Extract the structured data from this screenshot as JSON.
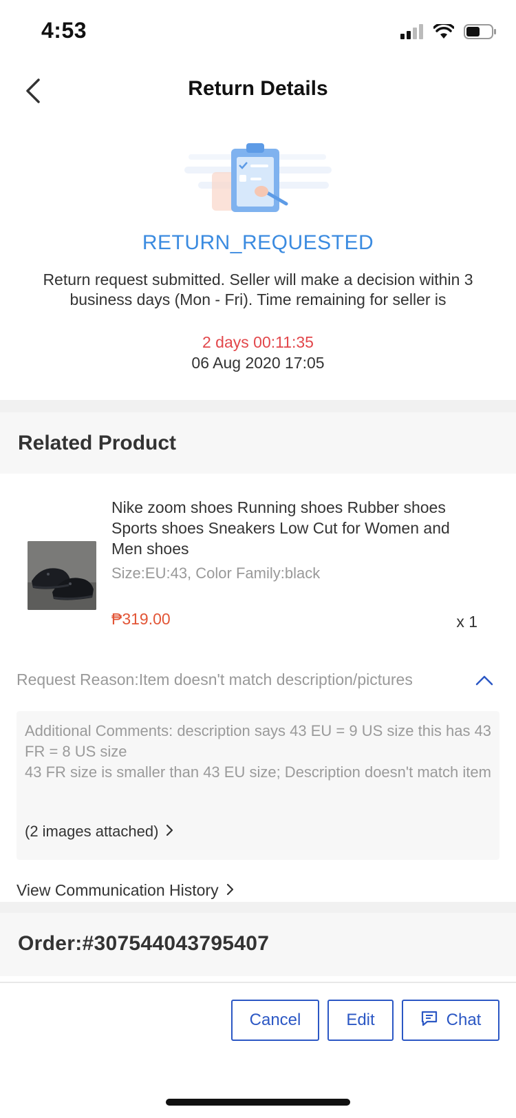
{
  "status_bar": {
    "time": "4:53",
    "icons": [
      "cellular-signal-icon",
      "wifi-icon",
      "battery-icon"
    ]
  },
  "nav": {
    "back_icon": "chevron-left-icon",
    "title": "Return Details"
  },
  "hero": {
    "illustration": "clipboard-checklist-illustration",
    "status": "RETURN_REQUESTED",
    "description": "Return request submitted. Seller will make a decision within 3 business days (Mon - Fri). Time remaining for seller is",
    "timer": "2 days 00:11:35",
    "date": "06 Aug 2020 17:05"
  },
  "related_product": {
    "section_title": "Related Product",
    "name": "Nike zoom shoes Running shoes Rubber shoes Sports shoes Sneakers Low Cut for Women and Men shoes",
    "variant": "Size:EU:43, Color Family:black",
    "price": "₱319.00",
    "quantity": "x 1",
    "thumbnail": "black-sneakers-photo"
  },
  "request": {
    "reason": "Request Reason:Item doesn't match description/pictures",
    "toggle_icon": "chevron-up-icon",
    "comments_line1": "Additional Comments: description says 43 EU = 9 US size this has 43 FR = 8 US size",
    "comments_line2": "43 FR size is smaller than 43 EU size; Description doesn't match item",
    "attachments": "(2 images attached)",
    "history_link": "View Communication History"
  },
  "order": {
    "number": "Order:#307544043795407"
  },
  "actions": {
    "cancel": "Cancel",
    "edit": "Edit",
    "chat": "Chat",
    "chat_icon": "chat-bubble-icon"
  },
  "colors": {
    "accent_blue": "#3b8be0",
    "button_blue": "#2b57c4",
    "timer_red": "#e2474b",
    "price_red": "#e25536",
    "band_gray": "#f1f1f1",
    "section_gray": "#f7f7f7"
  }
}
